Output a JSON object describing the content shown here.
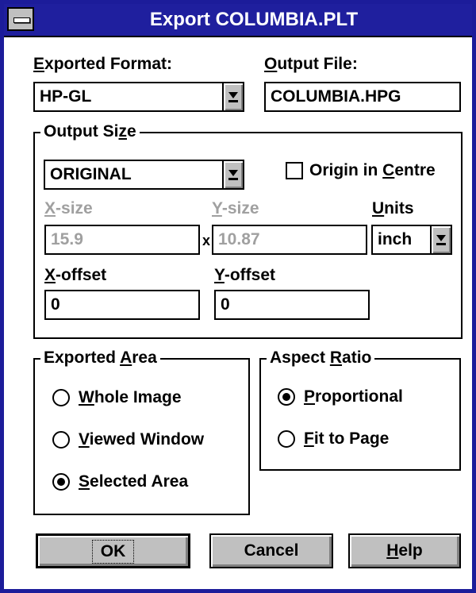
{
  "window": {
    "title": "Export COLUMBIA.PLT"
  },
  "exported_format": {
    "label_accel": "E",
    "label_rest": "xported Format:",
    "value": "HP-GL"
  },
  "output_file": {
    "label_accel": "O",
    "label_rest": "utput File:",
    "value": "COLUMBIA.HPG"
  },
  "output_size": {
    "legend_pre": "Output Si",
    "legend_accel": "z",
    "legend_post": "e",
    "size_value": "ORIGINAL",
    "origin_pre": "Origin in ",
    "origin_accel": "C",
    "origin_post": "entre",
    "origin_checked": false,
    "xsize_accel": "X",
    "xsize_rest": "-size",
    "xsize_value": "15.9",
    "times": "x",
    "ysize_accel": "Y",
    "ysize_rest": "-size",
    "ysize_value": "10.87",
    "units_accel": "U",
    "units_rest": "nits",
    "units_value": "inch",
    "xoffset_accel": "X",
    "xoffset_rest": "-offset",
    "xoffset_value": "0",
    "yoffset_accel": "Y",
    "yoffset_rest": "-offset",
    "yoffset_value": "0"
  },
  "exported_area": {
    "legend_pre": "Exported ",
    "legend_accel": "A",
    "legend_post": "rea",
    "options": [
      {
        "accel": "W",
        "rest": "hole Image",
        "selected": false
      },
      {
        "accel": "V",
        "rest": "iewed Window",
        "selected": false
      },
      {
        "accel": "S",
        "rest": "elected Area",
        "selected": true
      }
    ]
  },
  "aspect_ratio": {
    "legend_pre": "Aspect ",
    "legend_accel": "R",
    "legend_post": "atio",
    "options": [
      {
        "accel": "P",
        "rest": "roportional",
        "selected": true
      },
      {
        "accel": "F",
        "rest": "it to Page",
        "selected": false
      }
    ]
  },
  "buttons": {
    "ok": "OK",
    "cancel": "Cancel",
    "help_accel": "H",
    "help_rest": "elp"
  },
  "colors": {
    "title_bar": "#1f1f9e",
    "disabled_text": "#a0a0a0",
    "button_face": "#c0c0c0"
  }
}
